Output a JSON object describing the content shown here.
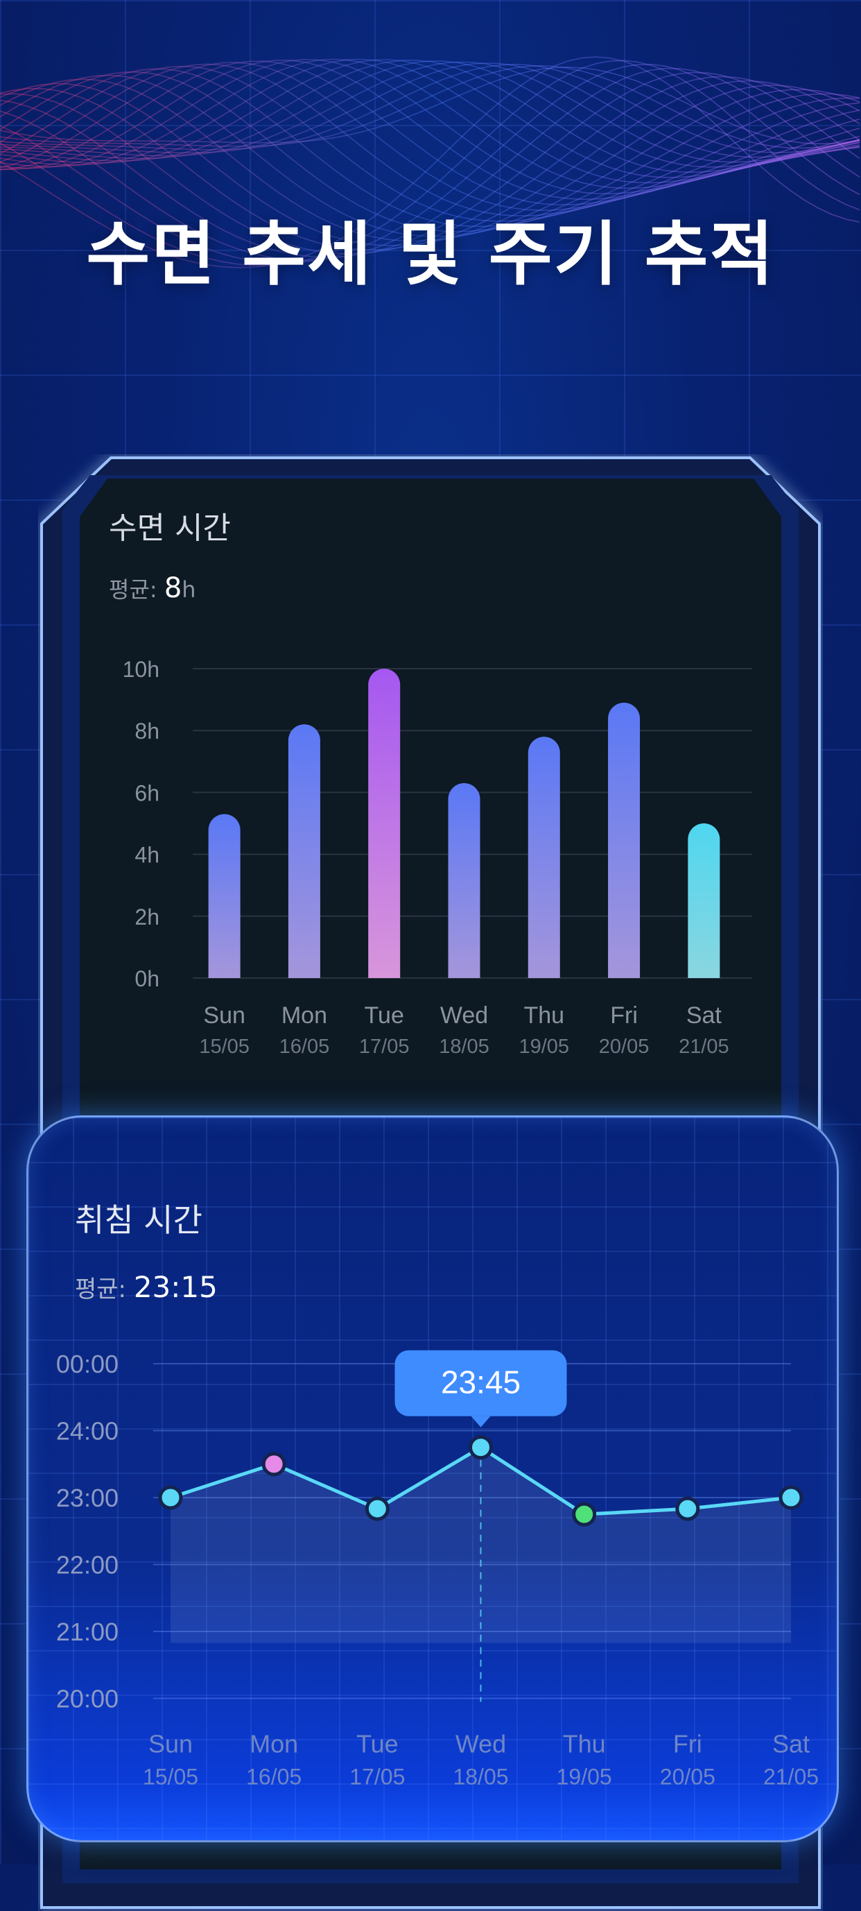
{
  "headline": "수면 추세 및 주기 추적",
  "sleep_card": {
    "title": "수면 시간",
    "avg_label": "평균:",
    "avg_value": "8",
    "avg_unit": "h"
  },
  "bedtime_card": {
    "title": "취침 시간",
    "avg_label": "평균:",
    "avg_value": "23:15",
    "tooltip": "23:45"
  },
  "colors": {
    "bar_gradient_top": "#5a78f5",
    "bar_gradient_bottom": "#a596db",
    "bar_highlight_top": "#a558f0",
    "bar_highlight_bottom": "#d896db",
    "bar_low_top": "#4fd6f0",
    "bar_low_bottom": "#8ad6e0",
    "line": "#5ad8f6",
    "dot_pink": "#e58ae9",
    "dot_green": "#4fe07a",
    "tooltip": "#3f8cff"
  },
  "chart_data": [
    {
      "type": "bar",
      "categories": [
        "Sun",
        "Mon",
        "Tue",
        "Wed",
        "Thu",
        "Fri",
        "Sat"
      ],
      "dates": [
        "15/05",
        "16/05",
        "17/05",
        "18/05",
        "19/05",
        "20/05",
        "21/05"
      ],
      "values": [
        5.3,
        8.2,
        10.0,
        6.3,
        7.8,
        8.9,
        5.0
      ],
      "yticks": [
        "10h",
        "8h",
        "6h",
        "4h",
        "2h",
        "0h"
      ],
      "ylim": [
        0,
        10
      ],
      "grid": true
    },
    {
      "type": "line",
      "categories": [
        "Sun",
        "Mon",
        "Tue",
        "Wed",
        "Thu",
        "Fri",
        "Sat"
      ],
      "dates": [
        "15/05",
        "16/05",
        "17/05",
        "18/05",
        "19/05",
        "20/05",
        "21/05"
      ],
      "yticks": [
        "00:00",
        "24:00",
        "23:00",
        "22:00",
        "21:00",
        "20:00"
      ],
      "values": [
        "23:00",
        "23:30",
        "22:50",
        "23:45",
        "22:45",
        "22:50",
        "23:00"
      ],
      "highlight_index": 3,
      "grid": true
    }
  ]
}
